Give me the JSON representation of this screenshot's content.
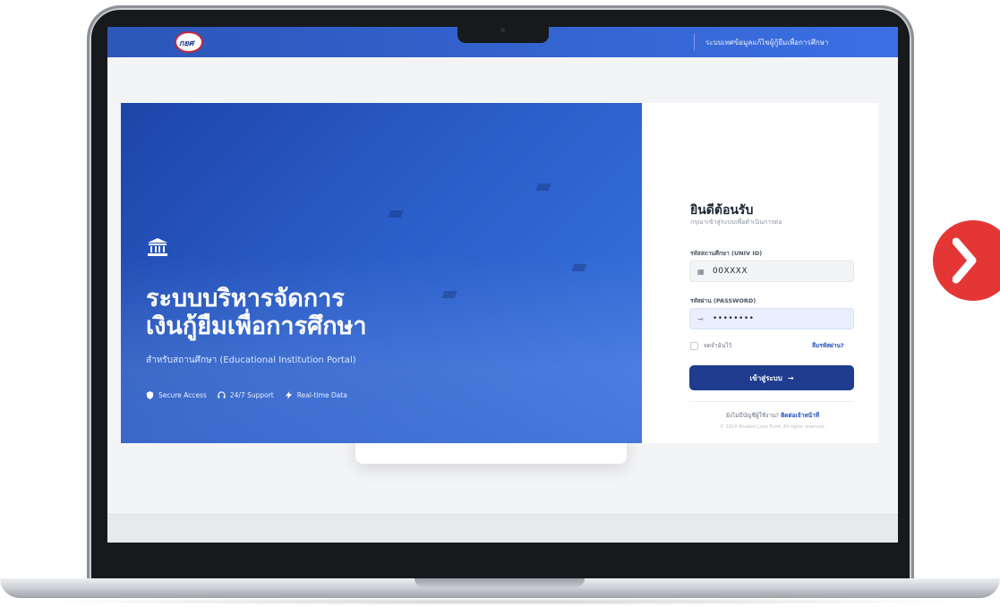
{
  "nav": {
    "logo_text": "กยศ",
    "right_text": "ระบบเทศข้อมูลแก้ไขผู้กู้ยืมเพื่อการศึกษา"
  },
  "hero": {
    "title_line1": "ระบบบริหารจัดการ",
    "title_line2": "เงินกู้ยืมเพื่อการศึกษา",
    "subtitle": "สำหรับสถานศึกษา (Educational Institution Portal)",
    "features": [
      {
        "label": "Secure Access",
        "icon": "shield-icon"
      },
      {
        "label": "24/7 Support",
        "icon": "headset-icon"
      },
      {
        "label": "Real-time Data",
        "icon": "lightning-icon"
      }
    ]
  },
  "login": {
    "welcome_title": "ยินดีต้อนรับ",
    "welcome_subtitle": "กรุณาเข้าสู่ระบบเพื่อดำเนินการต่อ",
    "univ_label": "รหัสสถานศึกษา (UNIV ID)",
    "univ_value": "00XXXX",
    "password_label": "รหัสผ่าน (PASSWORD)",
    "password_value": "••••••••",
    "remember_label": "จดจำฉันไว้",
    "forgot_label": "ลืมรหัสผ่าน?",
    "submit_label": "เข้าสู่ระบบ",
    "submit_arrow": "→",
    "register_text": "ยังไม่มีบัญชีผู้ใช้งาน?",
    "register_link": "ติดต่อเจ้าหน้าที่",
    "copyright": "© 2024 Student Loan Fund. All rights reserved."
  },
  "colors": {
    "brand_blue": "#2c56b8",
    "button_navy": "#1f3c8e",
    "badge_red": "#e53636"
  }
}
